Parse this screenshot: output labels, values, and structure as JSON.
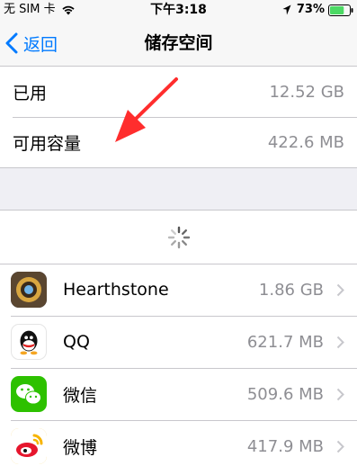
{
  "status_bar": {
    "carrier": "无 SIM 卡",
    "time": "下午3:18",
    "battery_percent": "73%",
    "battery_level": 0.73,
    "icons": [
      "wifi-icon",
      "location-icon",
      "battery-icon"
    ]
  },
  "nav": {
    "back_label": "返回",
    "title": "储存空间"
  },
  "summary": [
    {
      "label": "已用",
      "value": "12.52 GB"
    },
    {
      "label": "可用容量",
      "value": "422.6 MB"
    }
  ],
  "apps": [
    {
      "name": "Hearthstone",
      "size": "1.86 GB",
      "icon": "hearthstone-icon"
    },
    {
      "name": "QQ",
      "size": "621.7 MB",
      "icon": "qq-icon"
    },
    {
      "name": "微信",
      "size": "509.6 MB",
      "icon": "wechat-icon"
    },
    {
      "name": "微博",
      "size": "417.9 MB",
      "icon": "weibo-icon"
    }
  ],
  "colors": {
    "accent": "#007aff",
    "annotation_arrow": "#ff2d2d",
    "battery_fill": "#4cd964",
    "background": "#efeff4"
  }
}
